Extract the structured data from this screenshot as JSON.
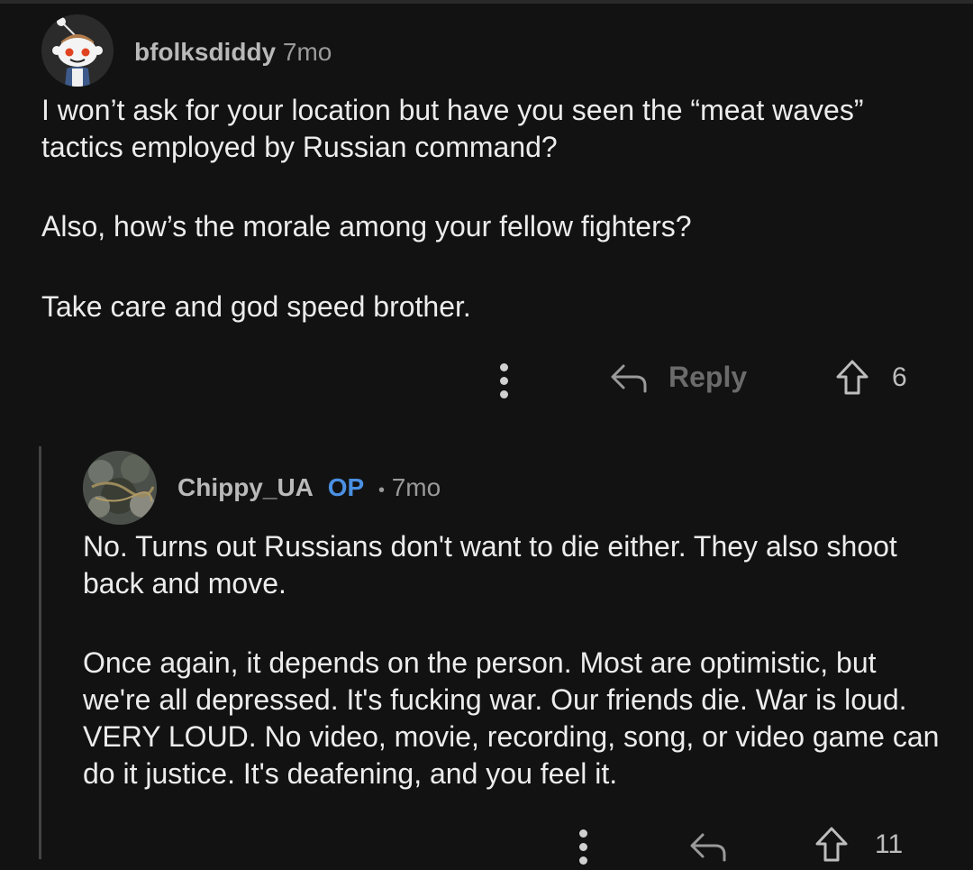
{
  "comments": [
    {
      "username": "bfolksdiddy",
      "time": "7mo",
      "paragraphs": [
        "I won’t ask for your location but have you seen the “meat waves” tactics employed by Russian command?",
        "Also, how’s the morale among your fellow fighters?",
        "Take care and god speed brother."
      ],
      "reply_label": "Reply",
      "upvotes": "6",
      "avatar_icon": "snoo-avatar-icon"
    },
    {
      "username": "Chippy_UA",
      "op_badge": "OP",
      "separator": "•",
      "time": "7mo",
      "paragraphs": [
        "No. Turns out Russians don't want to die either. They also shoot back and move.",
        "Once again, it depends on the person. Most are optimistic, but we're all depressed. It's fucking war. Our friends die. War is loud. VERY LOUD. No video, movie, recording, song, or video game can do it justice. It's deafening, and you feel it."
      ],
      "upvotes": "11",
      "avatar_icon": "photo-avatar-icon"
    }
  ],
  "colors": {
    "background": "#121212",
    "op_accent": "#4a90e2",
    "reply_disabled": "#6b6b6b"
  }
}
